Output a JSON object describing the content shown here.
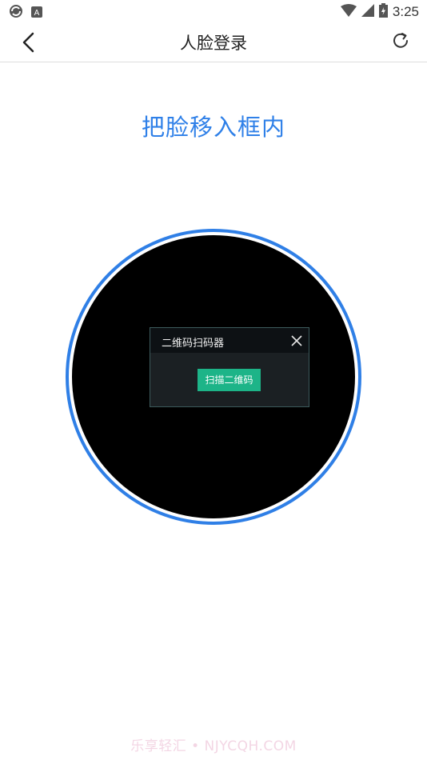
{
  "status_bar": {
    "time": "3:25",
    "icons": [
      "sync-icon",
      "text-a-icon",
      "wifi-icon",
      "signal-icon",
      "battery-icon"
    ]
  },
  "nav": {
    "title": "人脸登录",
    "icons": [
      "back-arrow-icon",
      "refresh-icon"
    ]
  },
  "main": {
    "instruction": "把脸移入框内"
  },
  "dialog": {
    "title": "二维码扫码器",
    "button_label": "扫描二维码"
  },
  "watermark": "乐享轻汇 • NJYCQH.COM",
  "colors": {
    "accent": "#2f80e8",
    "button": "#1db488",
    "camera_bg": "#000000"
  }
}
